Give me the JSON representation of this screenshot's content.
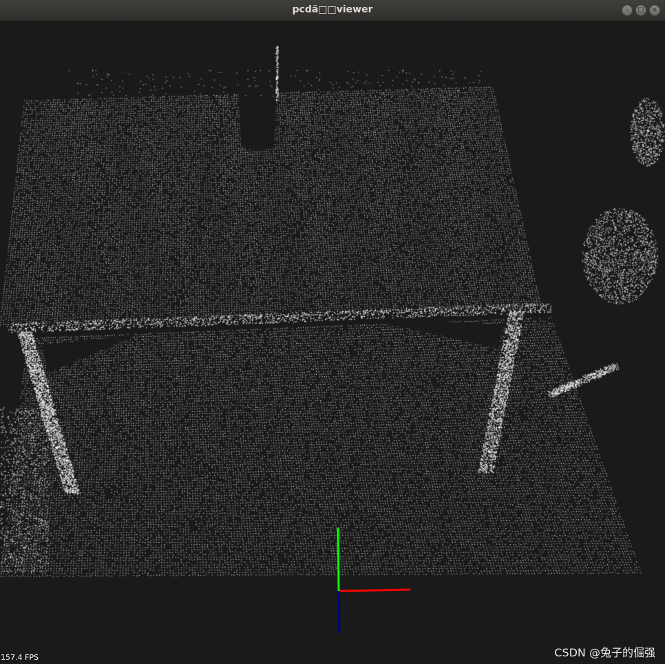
{
  "window": {
    "title": "pcdä□□viewer",
    "buttons": {
      "minimize": "–",
      "maximize": "□",
      "close": "×"
    }
  },
  "viewer": {
    "fps_label": "157.4 FPS",
    "background_color": "#1a1a1a",
    "point_color": "#ffffff",
    "axes": {
      "x_color": "#ff0000",
      "y_color": "#00ff00",
      "z_color": "#0000ff"
    }
  },
  "watermark": "CSDN @兔子的倔强"
}
